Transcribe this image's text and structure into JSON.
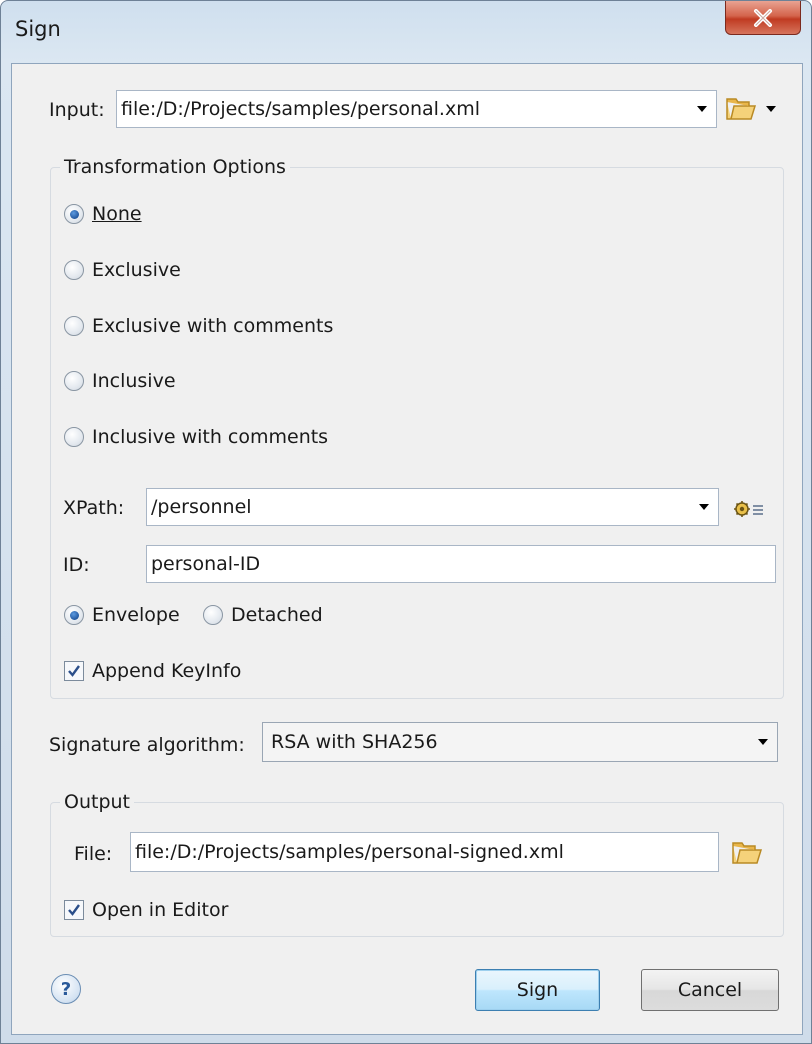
{
  "window": {
    "title": "Sign"
  },
  "input": {
    "label": "Input:",
    "value": "file:/D:/Projects/samples/personal.xml"
  },
  "transformation": {
    "title": "Transformation Options",
    "options": [
      {
        "label": "None",
        "checked": true
      },
      {
        "label": "Exclusive",
        "checked": false
      },
      {
        "label": "Exclusive with comments",
        "checked": false
      },
      {
        "label": "Inclusive",
        "checked": false
      },
      {
        "label": "Inclusive with comments",
        "checked": false
      }
    ],
    "xpath": {
      "label": "XPath:",
      "value": "/personnel"
    },
    "id": {
      "label": "ID:",
      "value": "personal-ID"
    },
    "mode": {
      "envelope_label": "Envelope",
      "detached_label": "Detached",
      "selected": "Envelope"
    },
    "append_keyinfo": {
      "label": "Append KeyInfo",
      "checked": true
    }
  },
  "signature": {
    "label": "Signature algorithm:",
    "value": "RSA with SHA256"
  },
  "output": {
    "title": "Output",
    "file": {
      "label": "File:",
      "value": "file:/D:/Projects/samples/personal-signed.xml"
    },
    "open_in_editor": {
      "label": "Open in Editor",
      "checked": true
    }
  },
  "buttons": {
    "sign": "Sign",
    "cancel": "Cancel"
  },
  "icons": {
    "close": "close-icon",
    "folder": "folder-open-icon",
    "xpath": "xpath-settings-icon",
    "help": "help-icon"
  },
  "colors": {
    "accent": "#1b4f96",
    "close_button": "#c8452b",
    "folder": "#e9b64a"
  }
}
